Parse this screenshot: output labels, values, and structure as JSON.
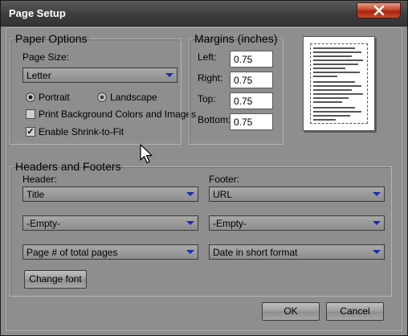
{
  "window": {
    "title": "Page Setup"
  },
  "paper_options": {
    "legend": "Paper Options",
    "page_size_label": "Page Size:",
    "page_size_value": "Letter",
    "orientation": {
      "portrait_label": "Portrait",
      "landscape_label": "Landscape",
      "selected": "Portrait"
    },
    "print_background": {
      "label": "Print Background Colors and Images",
      "checked": false
    },
    "shrink_to_fit": {
      "label": "Enable Shrink-to-Fit",
      "checked": true,
      "mark": "✓"
    }
  },
  "margins": {
    "legend": "Margins (inches)",
    "left_label": "Left:",
    "left_value": "0.75",
    "right_label": "Right:",
    "right_value": "0.75",
    "top_label": "Top:",
    "top_value": "0.75",
    "bottom_label": "Bottom:",
    "bottom_value": "0.75"
  },
  "headers_footers": {
    "legend": "Headers and Footers",
    "header_label": "Header:",
    "footer_label": "Footer:",
    "header_values": [
      "Title",
      "-Empty-",
      "Page # of total pages"
    ],
    "footer_values": [
      "URL",
      "-Empty-",
      "Date in short format"
    ],
    "change_font_label": "Change font"
  },
  "buttons": {
    "ok_label": "OK",
    "cancel_label": "Cancel"
  },
  "icons": {
    "close": "close-icon",
    "dropdown_arrow": "chevron-down-icon",
    "cursor": "mouse-pointer-icon"
  },
  "colors": {
    "dialog_bg": "#8e8e8e",
    "close_button": "#c44a2e",
    "dropdown_arrow": "#1a2cb0"
  }
}
